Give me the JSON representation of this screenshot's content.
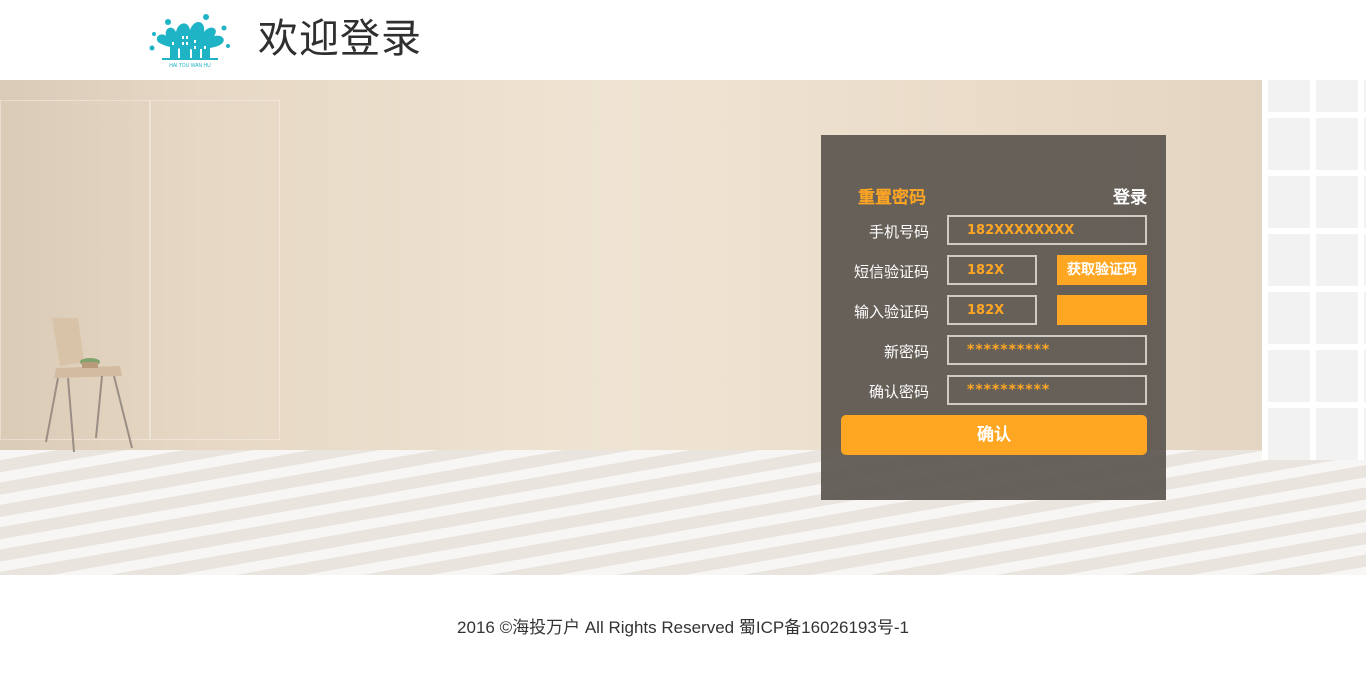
{
  "header": {
    "logo_text": "HAI TOU WAN HU",
    "title": "欢迎登录"
  },
  "panel": {
    "title": "重置密码",
    "login_link": "登录",
    "fields": [
      {
        "label": "手机号码",
        "value": "182XXXXXXXX"
      },
      {
        "label": "短信验证码",
        "value": "182X"
      },
      {
        "label": "输入验证码",
        "value": "182X"
      },
      {
        "label": "新密码",
        "value": "**********"
      },
      {
        "label": "确认密码",
        "value": "**********"
      }
    ],
    "get_code_button": "获取验证码",
    "confirm_button": "确认"
  },
  "footer": {
    "copyright": "2016 ©海投万户 All Rights Reserved   蜀ICP备16026193号-1"
  },
  "colors": {
    "accent": "#ffa623",
    "panel_bg": "#58524c",
    "text_dark": "#333333"
  },
  "icons": {
    "logo": "splash-building-logo"
  }
}
